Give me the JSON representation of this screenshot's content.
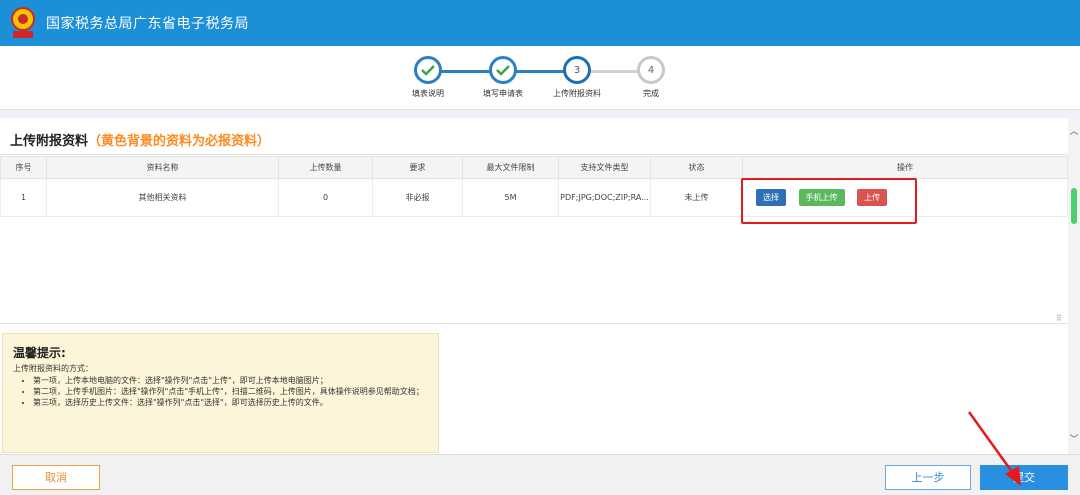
{
  "header": {
    "title": "国家税务总局广东省电子税务局",
    "logo_text": "中国税务"
  },
  "steps": [
    {
      "label": "填表说明",
      "number": "1",
      "state": "done"
    },
    {
      "label": "填写申请表",
      "number": "2",
      "state": "done"
    },
    {
      "label": "上传附报资料",
      "number": "3",
      "state": "current"
    },
    {
      "label": "完成",
      "number": "4",
      "state": "todo"
    }
  ],
  "panel": {
    "title": "上传附报资料",
    "hint": "（黄色背景的资料为必报资料）"
  },
  "table": {
    "headers": [
      "序号",
      "资料名称",
      "上传数量",
      "要求",
      "最大文件限制",
      "支持文件类型",
      "状态",
      "操作"
    ],
    "rows": [
      {
        "index": "1",
        "name": "其他相关资料",
        "count": "0",
        "requirement": "非必报",
        "max_size": "5M",
        "types": "PDF;JPG;DOC;ZIP;RA...",
        "status": "未上传",
        "actions": {
          "select": "选择",
          "mobile": "手机上传",
          "upload": "上传"
        }
      }
    ]
  },
  "tips": {
    "title": "温馨提示:",
    "intro": "上传附报资料的方式：",
    "items": [
      "第一项，上传本地电脑的文件：选择\"操作列\"点击\"上传\"，即可上传本地电脑图片；",
      "第二项，上传手机图片：选择\"操作列\"点击\"手机上传\"，扫描二维码，上传图片，具体操作说明参见帮助文档；",
      "第三项，选择历史上传文件：选择\"操作列\"点击\"选择\"，即可选择历史上传的文件。"
    ]
  },
  "footer": {
    "cancel": "取消",
    "prev": "上一步",
    "submit": "提交"
  },
  "colors": {
    "header": "#1d8fd8",
    "step_done": "#2c7fc3",
    "required_hint": "#ff8a1f",
    "status_red": "#e02020",
    "highlight_box": "#e31b1b"
  }
}
